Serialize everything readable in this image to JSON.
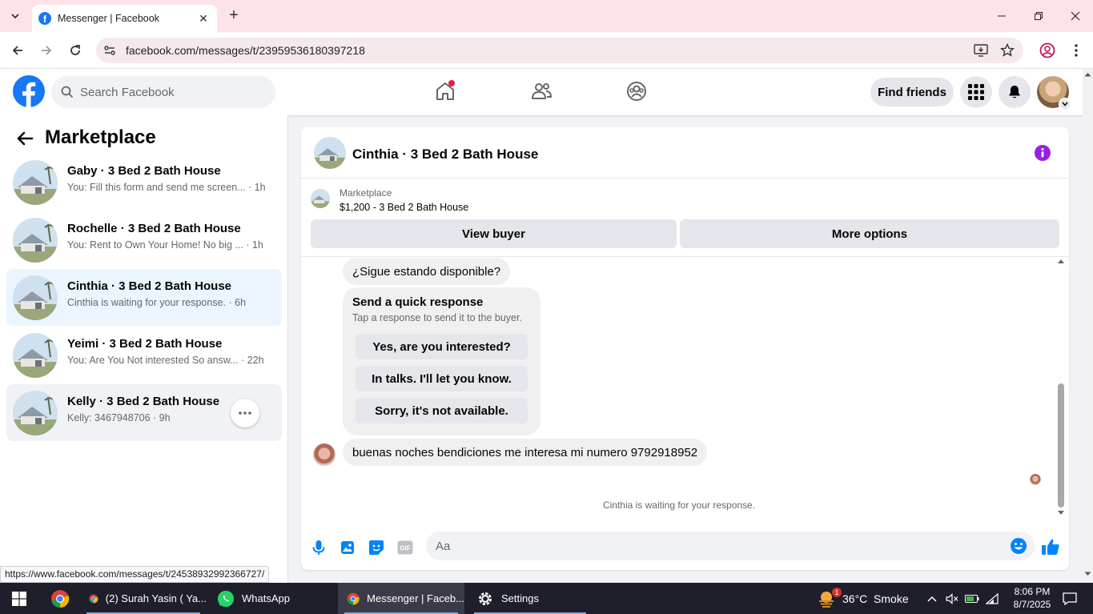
{
  "browser": {
    "tab_title": "Messenger | Facebook",
    "url": "facebook.com/messages/t/23959536180397218",
    "status_link": "https://www.facebook.com/messages/t/24538932992366727/"
  },
  "header": {
    "search_placeholder": "Search Facebook",
    "find_friends_label": "Find friends",
    "home_badge_color": "#e41e3f",
    "brand_color": "#1877f2"
  },
  "sidebar": {
    "title": "Marketplace",
    "conversations": [
      {
        "name": "Gaby · 3 Bed 2 Bath House",
        "preview": "You: Fill this form and send me screen... · 1h"
      },
      {
        "name": "Rochelle · 3 Bed 2 Bath House",
        "preview": "You: Rent to Own Your Home! No big ... · 1h"
      },
      {
        "name": "Cinthia · 3 Bed 2 Bath House",
        "preview": "Cinthia is waiting for your response. · 6h"
      },
      {
        "name": "Yeimi · 3 Bed 2 Bath House",
        "preview": "You: Are You Not interested So answ... · 22h"
      },
      {
        "name": "Kelly · 3 Bed 2 Bath House",
        "preview": "Kelly: 3467948706 · 9h"
      }
    ]
  },
  "chat": {
    "title": "Cinthia · 3 Bed 2 Bath House",
    "listing_source": "Marketplace",
    "listing_price": "$1,200 - 3 Bed 2 Bath House",
    "view_buyer_label": "View buyer",
    "more_options_label": "More options",
    "first_message": "¿Sigue estando disponible?",
    "quick_title": "Send a quick response",
    "quick_subtitle": "Tap a response to send it to the buyer.",
    "quick_options": [
      "Yes, are you interested?",
      "In talks. I'll let you know.",
      "Sorry, it's not available."
    ],
    "buyer_message": "buenas noches bendiciones me interesa mi numero 9792918952",
    "waiting_text": "Cinthia is waiting for your response.",
    "input_placeholder": "Aa",
    "accent_color": "#0084ff"
  },
  "taskbar": {
    "items": [
      {
        "label": "(2) Surah Yasin ( Ya..."
      },
      {
        "label": "WhatsApp"
      },
      {
        "label": "Messenger | Faceb..."
      },
      {
        "label": "Settings"
      }
    ],
    "weather": "36°C  Smoke",
    "weather_badge": "1",
    "time": "8:06 PM",
    "date": "8/7/2025"
  }
}
